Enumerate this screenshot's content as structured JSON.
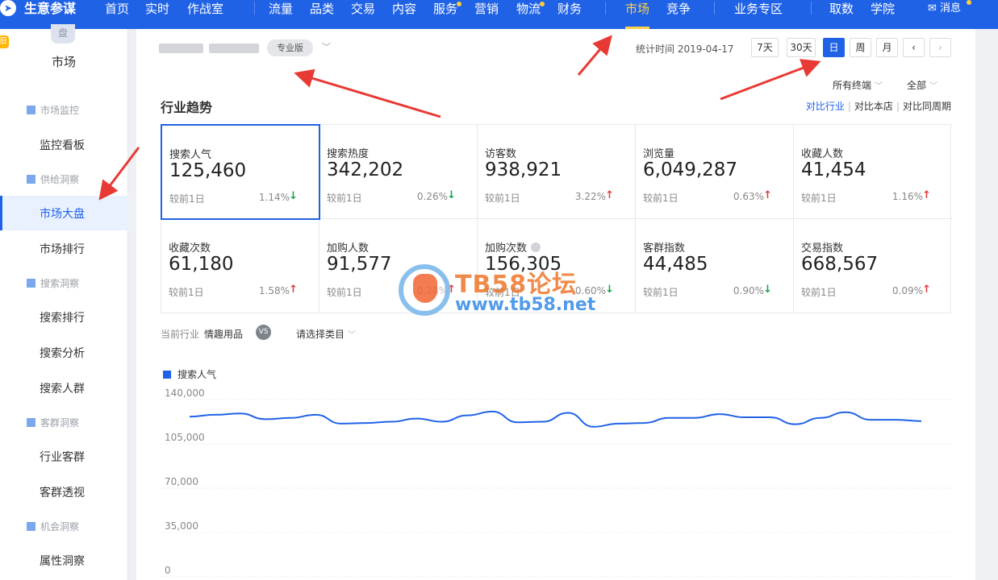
{
  "topnav": {
    "brand": "生意参谋",
    "items": [
      "首页",
      "实时",
      "作战室",
      "流量",
      "品类",
      "交易",
      "内容",
      "服务",
      "营销",
      "物流",
      "财务",
      "市场",
      "竞争",
      "业务专区",
      "取数",
      "学院"
    ],
    "active": "市场",
    "message": "消息"
  },
  "sidebar": {
    "tag": "旧",
    "section_icon": "盘",
    "section_title": "市场",
    "groups": [
      {
        "title": "市场监控",
        "items": [
          "监控看板"
        ]
      },
      {
        "title": "供给洞察",
        "items": [
          "市场大盘",
          "市场排行"
        ]
      },
      {
        "title": "搜索洞察",
        "items": [
          "搜索排行",
          "搜索分析",
          "搜索人群"
        ]
      },
      {
        "title": "客群洞察",
        "items": [
          "行业客群",
          "客群透视"
        ]
      },
      {
        "title": "机会洞察",
        "items": [
          "属性洞察"
        ]
      }
    ],
    "selected": "市场大盘"
  },
  "header": {
    "edition_badge": "专业版",
    "stat_time_label": "统计时间 2019-04-17",
    "periods": [
      "7天",
      "30天",
      "日",
      "周",
      "月"
    ],
    "active_period": "日",
    "prev": "‹",
    "next": "›",
    "terminal_filter": "所有终端",
    "scope_filter": "全部"
  },
  "trend": {
    "title": "行业趋势",
    "compare_links": [
      "对比行业",
      "对比本店",
      "对比同周期"
    ],
    "compare_label": "较前1日",
    "metrics": [
      {
        "label": "搜索人气",
        "value": "125,460",
        "pct": "1.14%",
        "dir": "down"
      },
      {
        "label": "搜索热度",
        "value": "342,202",
        "pct": "0.26%",
        "dir": "down"
      },
      {
        "label": "访客数",
        "value": "938,921",
        "pct": "3.22%",
        "dir": "up"
      },
      {
        "label": "浏览量",
        "value": "6,049,287",
        "pct": "0.63%",
        "dir": "up"
      },
      {
        "label": "收藏人数",
        "value": "41,454",
        "pct": "1.16%",
        "dir": "up"
      },
      {
        "label": "收藏次数",
        "value": "61,180",
        "pct": "1.58%",
        "dir": "up"
      },
      {
        "label": "加购人数",
        "value": "91,577",
        "pct": "0.28%",
        "dir": "up"
      },
      {
        "label": "加购次数",
        "value": "156,305",
        "pct": "0.60%",
        "dir": "down"
      },
      {
        "label": "客群指数",
        "value": "44,485",
        "pct": "0.90%",
        "dir": "down"
      },
      {
        "label": "交易指数",
        "value": "668,567",
        "pct": "0.09%",
        "dir": "up"
      }
    ]
  },
  "industry": {
    "label": "当前行业",
    "value": "情趣用品",
    "vs": "VS",
    "select_placeholder": "请选择类目"
  },
  "colors": {
    "brand": "#2062e6",
    "up": "#e23b3b",
    "down": "#16a34a",
    "accent": "#ffd24a"
  },
  "watermark": {
    "title": "TB58论坛",
    "url": "www.tb58.net"
  },
  "chart_data": {
    "type": "line",
    "series": [
      {
        "name": "搜索人气",
        "values": [
          126500,
          128000,
          129000,
          124500,
          125500,
          128000,
          121000,
          121500,
          122500,
          125000,
          122500,
          127500,
          130500,
          122000,
          122500,
          129500,
          118500,
          121000,
          121500,
          125500,
          125500,
          128500,
          126000,
          126000,
          120500,
          125500,
          130000,
          124000,
          124000,
          123000
        ]
      }
    ],
    "yticks": [
      140000,
      105000,
      70000,
      35000,
      0
    ],
    "ylim": [
      0,
      140000
    ],
    "xlabel": "",
    "ylabel": "",
    "legend": "top-left",
    "grid": true
  }
}
